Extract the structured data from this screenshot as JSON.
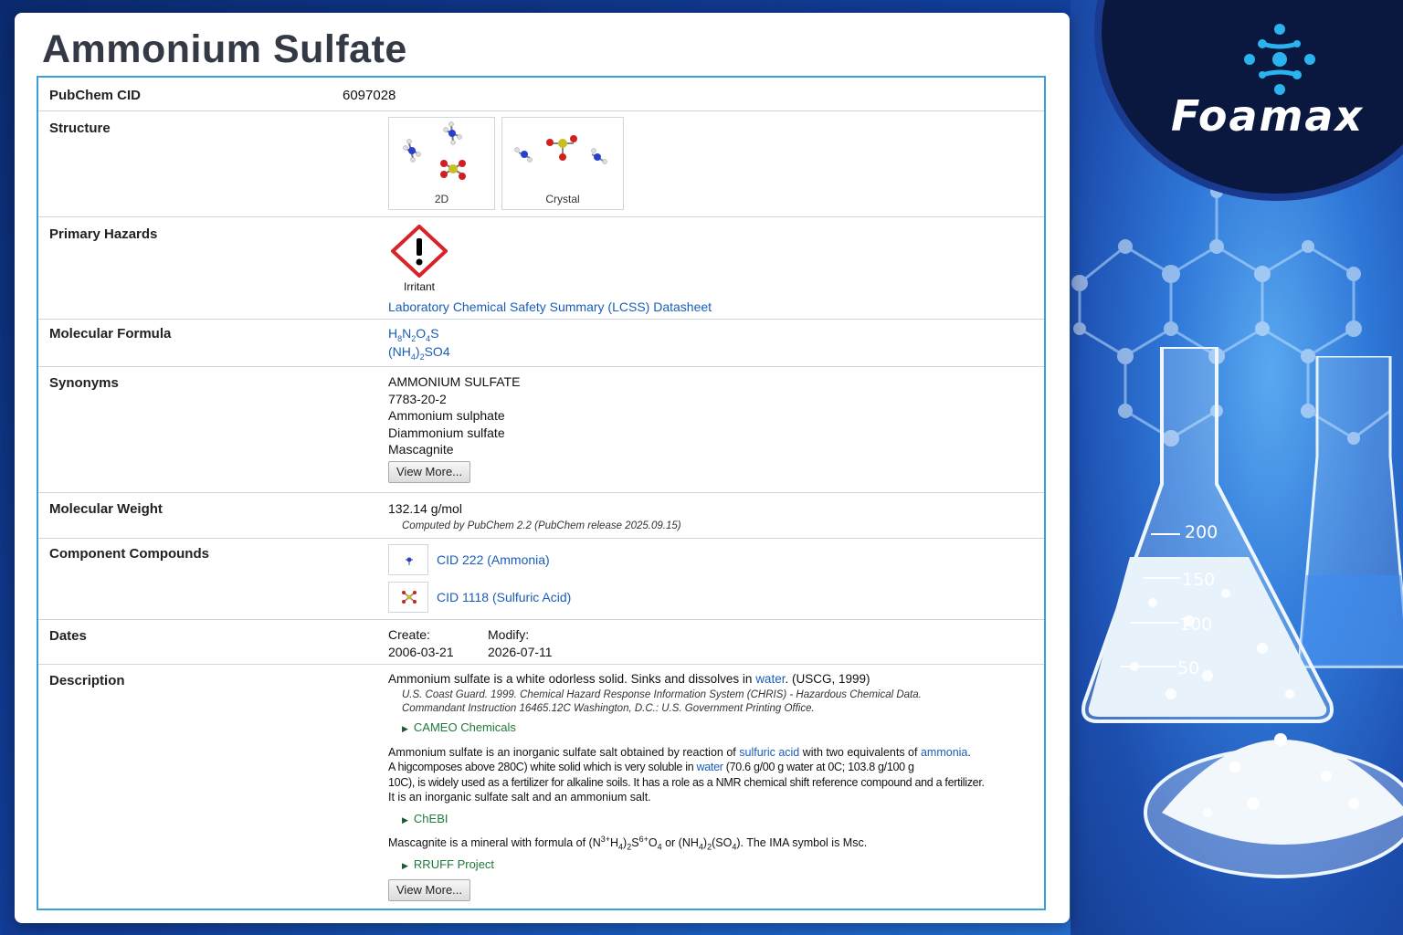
{
  "title": "Ammonium Sulfate",
  "brand": {
    "name": "Foamax"
  },
  "flask_graduations": [
    "200",
    "150",
    "100",
    "50"
  ],
  "rows": {
    "cid": {
      "label": "PubChem CID",
      "value": "6097028"
    },
    "structure": {
      "label": "Structure",
      "captions": [
        "2D",
        "Crystal"
      ]
    },
    "hazards": {
      "label": "Primary Hazards",
      "pictogram": "Irritant",
      "link": "Laboratory Chemical Safety Summary (LCSS) Datasheet"
    },
    "formula": {
      "label": "Molecular Formula",
      "line1_parts": [
        "H",
        "8",
        "N",
        "2",
        "O",
        "4",
        "S"
      ],
      "line2_parts": [
        "(NH",
        "4",
        ")",
        "2",
        "SO4"
      ]
    },
    "synonyms": {
      "label": "Synonyms",
      "items": [
        "AMMONIUM SULFATE",
        "7783-20-2",
        "Ammonium sulphate",
        "Diammonium sulfate",
        "Mascagnite"
      ],
      "button": "View More..."
    },
    "weight": {
      "label": "Molecular Weight",
      "value": "132.14 g/mol",
      "note": "Computed by PubChem 2.2 (PubChem release 2025.09.15)"
    },
    "components": {
      "label": "Component Compounds",
      "items": [
        "CID 222 (Ammonia)",
        "CID 1118 (Sulfuric Acid)"
      ]
    },
    "dates": {
      "label": "Dates",
      "create_label": "Create:",
      "create": "2006-03-21",
      "modify_label": "Modify:",
      "modify": "2026-07-11"
    },
    "description": {
      "label": "Description",
      "p1_a": "Ammonium sulfate is a white odorless solid. Sinks and dissolves in ",
      "p1_link": "water",
      "p1_b": ". (USCG, 1999)",
      "ref1_l1": "U.S. Coast Guard. 1999. Chemical Hazard Response Information System (CHRIS) - Hazardous Chemical Data.",
      "ref1_l2": "Commandant Instruction 16465.12C Washington, D.C.: U.S. Government Printing Office.",
      "src1": "CAMEO Chemicals",
      "p2_l1_a": "Ammonium sulfate is an inorganic sulfate salt obtained by reaction of ",
      "p2_l1_link1": "sulfuric acid",
      "p2_l1_b": " with two equivalents of ",
      "p2_l1_link2": "ammonia",
      "p2_l1_c": ".",
      "p2_l2_a": "A higcomposes above 280C) white solid which is very soluble in ",
      "p2_l2_link": "water",
      "p2_l2_b": " (70.6 g/00 g water at 0C; ",
      "p2_l2_c": "103.8 g/100 g ",
      "p2_l3": "10C), is widely used as a fertilizer for alkaline soils. It has a role as a NMR chemical shift reference compound and a fertilizer.",
      "p2_l4": "It is an inorganic sulfate salt and an ammonium salt.",
      "src2": "ChEBI",
      "p3_a": "Mascagnite is a mineral with formula of (N",
      "p3_sup1": "3+",
      "p3_b": "H",
      "p3_sub1": "4",
      "p3_c": ")",
      "p3_sub2": "2",
      "p3_d": "S",
      "p3_sup2": "6+",
      "p3_e": "O",
      "p3_sub3": "4",
      "p3_f": " or (NH",
      "p3_sub4": "4",
      "p3_g": ")",
      "p3_sub5": "2",
      "p3_h": "(SO",
      "p3_sub6": "4",
      "p3_i": "). The IMA symbol is Msc.",
      "src3": "RRUFF Project",
      "button": "View More..."
    }
  },
  "colors": {
    "accent_border": "#3aa0dc",
    "link": "#1a5db8",
    "source_green": "#1e7a3a",
    "hazard_red": "#d8232a"
  }
}
